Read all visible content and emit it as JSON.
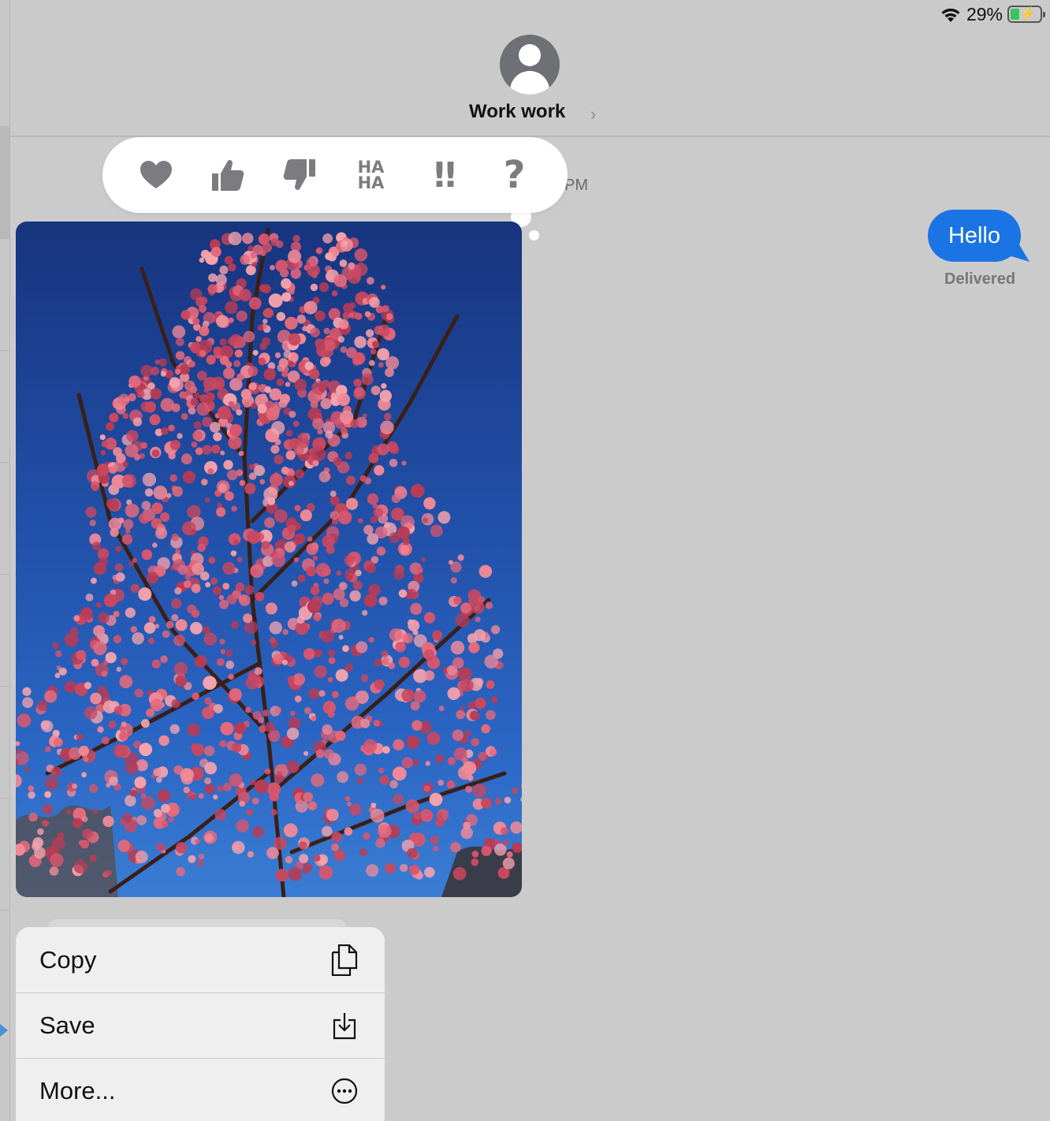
{
  "status_bar": {
    "battery_percent": "29%",
    "battery_level": 0.29,
    "charging": true,
    "wifi": "wifi-icon"
  },
  "header": {
    "contact_name": "Work work",
    "chevron": "›",
    "avatar_icon": "person-icon"
  },
  "conversation": {
    "timestamp_fragment": "PM",
    "outgoing_message": {
      "text": "Hello",
      "status": "Delivered",
      "color": "#1b74e4"
    }
  },
  "tapback": {
    "options": [
      {
        "name": "heart",
        "icon": "heart-icon"
      },
      {
        "name": "thumbs-up",
        "icon": "thumbs-up-icon"
      },
      {
        "name": "thumbs-down",
        "icon": "thumbs-down-icon"
      },
      {
        "name": "haha",
        "icon": "haha-icon",
        "line1": "HA",
        "line2": "HA"
      },
      {
        "name": "emphasize",
        "icon": "exclamation-icon",
        "glyph": "!!"
      },
      {
        "name": "question",
        "icon": "question-icon",
        "glyph": "?"
      }
    ]
  },
  "photo": {
    "subject": "photo-image"
  },
  "context_menu": {
    "items": [
      {
        "label": "Copy",
        "icon": "copy-icon"
      },
      {
        "label": "Save",
        "icon": "save-icon"
      },
      {
        "label": "More...",
        "icon": "more-icon"
      }
    ]
  }
}
